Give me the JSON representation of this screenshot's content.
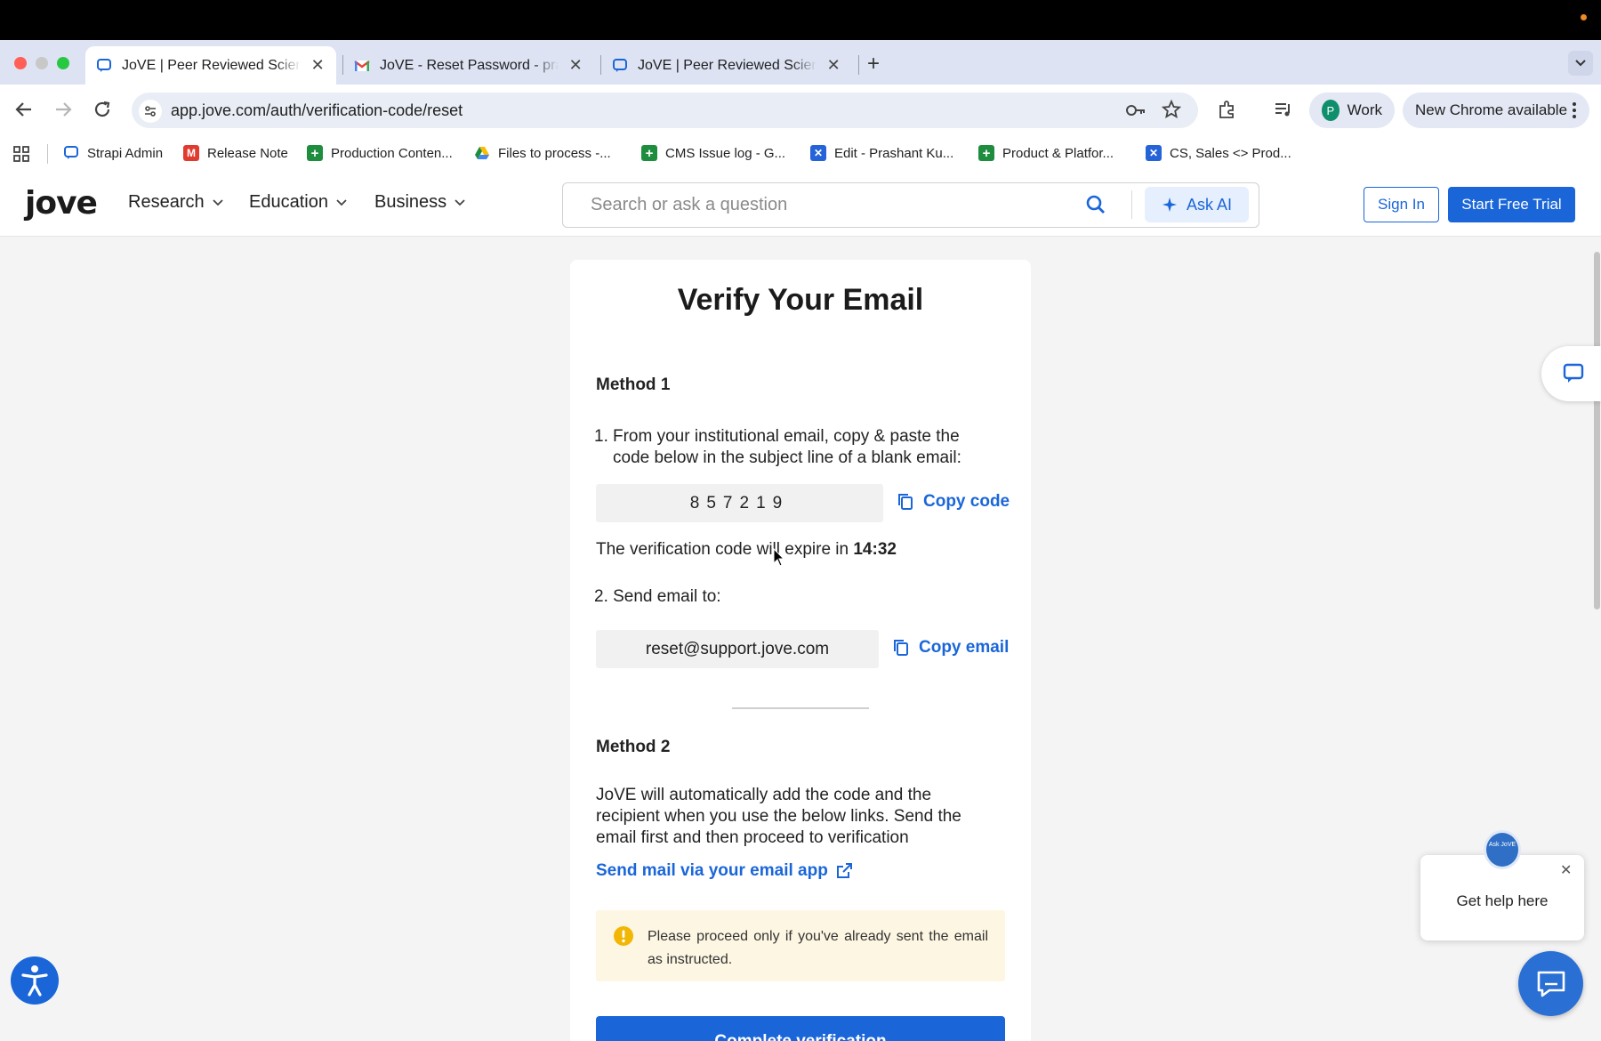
{
  "browser": {
    "tabs": [
      {
        "title": "JoVE | Peer Reviewed Scientific Video Journal"
      },
      {
        "title": "JoVE - Reset Password - prashant"
      },
      {
        "title": "JoVE | Peer Reviewed Scientific Video Journal"
      }
    ],
    "url": "app.jove.com/auth/verification-code/reset",
    "profile": {
      "initial": "P",
      "label": "Work"
    },
    "update_label": "New Chrome available",
    "bookmarks": [
      "Strapi Admin",
      "Release Note",
      "Production Conten...",
      "Files to process -...",
      "CMS Issue log - G...",
      "Edit - Prashant Ku...",
      "Product & Platfor...",
      "CS, Sales <> Prod..."
    ]
  },
  "site": {
    "logo": "jove",
    "nav": [
      "Research",
      "Education",
      "Business"
    ],
    "search_placeholder": "Search or ask a question",
    "ask_ai": "Ask AI",
    "sign_in": "Sign In",
    "start_trial": "Start Free Trial"
  },
  "verify": {
    "title": "Verify Your Email",
    "method1": {
      "heading": "Method 1",
      "step1_num": "1.",
      "step1_line1": "From your institutional email, copy & paste the",
      "step1_line2": "code below in the subject line of a blank email:",
      "code": "857219",
      "copy_code": "Copy code",
      "expire_text": "The verification code will expire in",
      "expire_time": "14:32",
      "step2": "2. Send email to:",
      "email": "reset@support.jove.com",
      "copy_email": "Copy email"
    },
    "method2": {
      "heading": "Method 2",
      "line1": "JoVE will automatically add the code and the",
      "line2": "recipient when you use the below links. Send the",
      "line3": "email first and then proceed to verification",
      "link": "Send mail via your email app"
    },
    "warning": "Please proceed only if you've already sent the email as instructed.",
    "cta": "Complete verification"
  },
  "widgets": {
    "help_text": "Get help here",
    "ask_badge": "Ask JoVE"
  },
  "colors": {
    "accent": "#1a66d9",
    "warning_bg": "#fdf6e2",
    "warning_icon": "#f2b705"
  }
}
